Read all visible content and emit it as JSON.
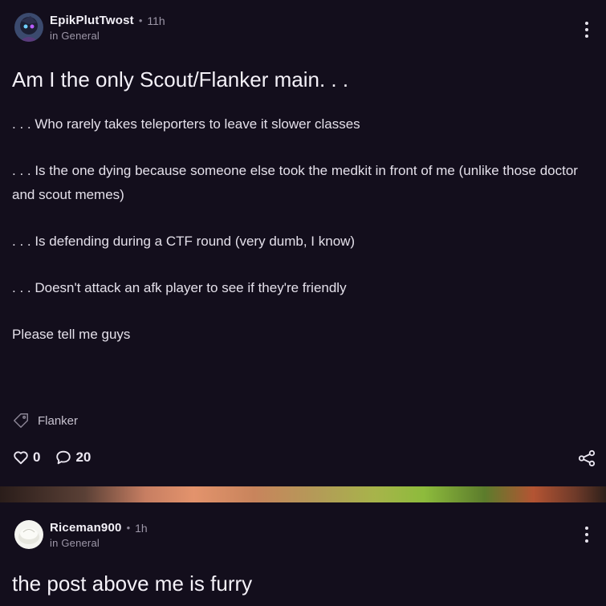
{
  "posts": [
    {
      "author": "EpikPlutTwost",
      "time": "11h",
      "community": "in General",
      "title": "Am I the only Scout/Flanker main. . .",
      "body": [
        ". . . Who rarely takes teleporters to leave it slower classes",
        ". . . Is the one dying because someone else took the medkit in front of me (unlike those doctor and scout memes)",
        ". . . Is defending during a CTF round (very dumb, I know)",
        ". . . Doesn't attack an afk player to see if they're friendly",
        "Please tell me guys"
      ],
      "tag": "Flanker",
      "likes": "0",
      "comments": "20"
    },
    {
      "author": "Riceman900",
      "time": "1h",
      "community": "in General",
      "title": "the post above me is furry"
    }
  ],
  "icons": {
    "more": "more-vertical-icon",
    "tag": "tag-icon",
    "like": "heart-icon",
    "comment": "comment-icon",
    "share": "share-icon"
  },
  "colors": {
    "background": "#130e1c",
    "text": "#ece8f2",
    "muted": "#9d97a8"
  }
}
